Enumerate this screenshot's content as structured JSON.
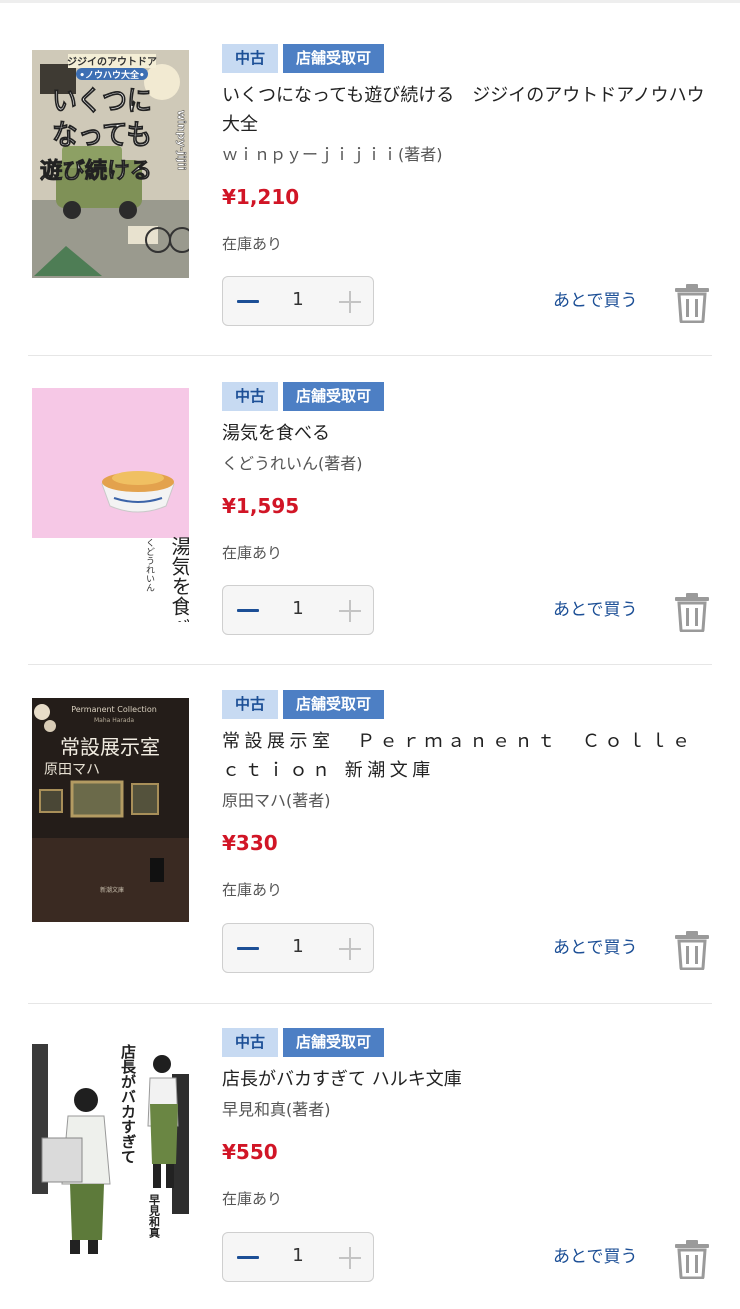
{
  "tags": {
    "used": "中古",
    "store": "店舗受取可"
  },
  "actions": {
    "buy_later": "あとで買う",
    "stock_label": "在庫あり"
  },
  "colors": {
    "tag_used_bg": "#c7daf2",
    "tag_store_bg": "#4d7fc4",
    "price": "#d11526",
    "link": "#1c4f96"
  },
  "items": [
    {
      "title": "いくつになっても遊び続ける　ジジイのアウトドアノウハウ大全",
      "author": "ｗｉｎｐｙーｊｉｊｉｉ(著者)",
      "price": "¥1,210",
      "quantity": "1",
      "cover": {
        "band": "ジジイのアウトドア",
        "band2": "•ノウハウ大全•",
        "big1": "いくつに",
        "big2": "なっても",
        "big3": "遊び続ける",
        "side": "winpy-jijii"
      }
    },
    {
      "title": "湯気を食べる",
      "author": "くどうれいん(著者)",
      "price": "¥1,595",
      "quantity": "1",
      "cover": {
        "title": "湯気を食べる",
        "author": "くどうれいん"
      }
    },
    {
      "title": "常設展示室　Ｐｅｒｍａｎｅｎｔ　Ｃｏｌｌｅｃｔｉｏｎ 新潮文庫",
      "author": "原田マハ(著者)",
      "price": "¥330",
      "quantity": "1",
      "cover": {
        "top": "Permanent Collection",
        "sub": "Maha Harada",
        "title": "常設展示室",
        "author": "原田マハ",
        "label": "新潮文庫"
      }
    },
    {
      "title": "店長がバカすぎて ハルキ文庫",
      "author": "早見和真(著者)",
      "price": "¥550",
      "quantity": "1",
      "cover": {
        "title": "店長がバカすぎて",
        "author": "早見和真"
      }
    }
  ]
}
